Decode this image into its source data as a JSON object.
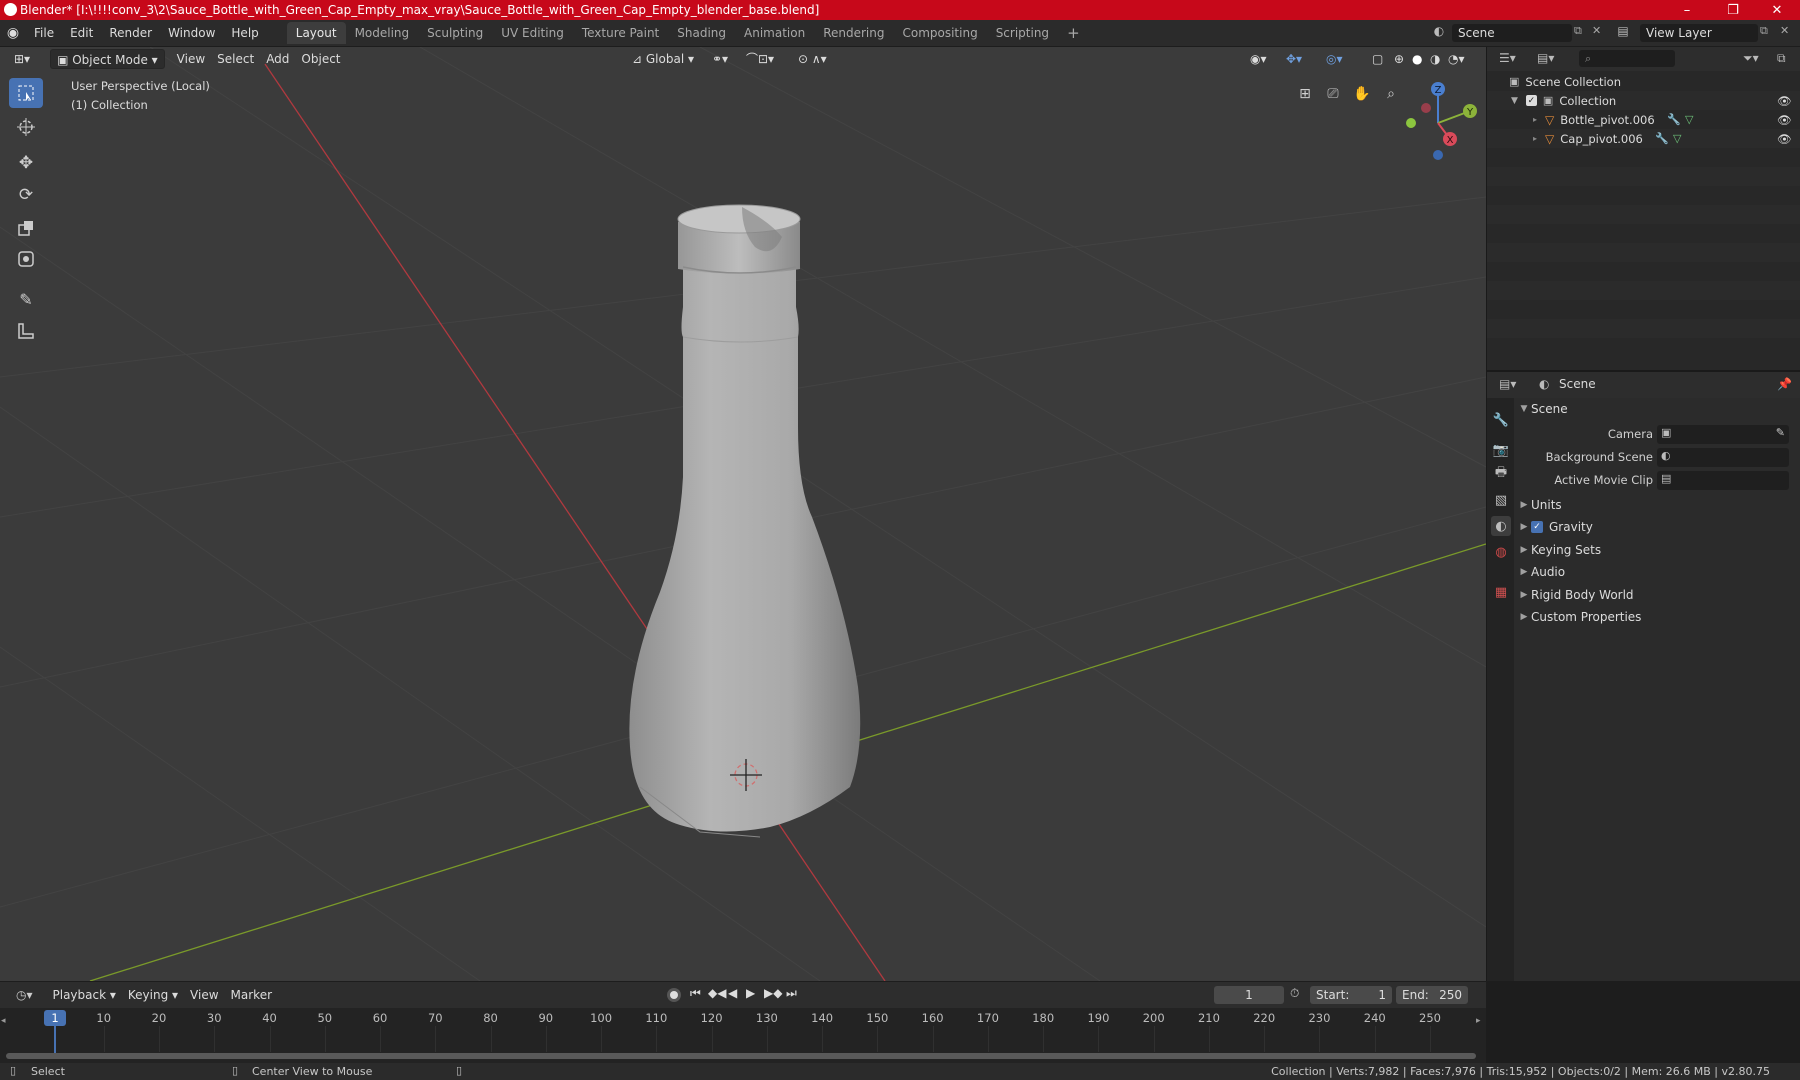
{
  "window": {
    "title": "Blender* [I:\\!!!!conv_3\\2\\Sauce_Bottle_with_Green_Cap_Empty_max_vray\\Sauce_Bottle_with_Green_Cap_Empty_blender_base.blend]",
    "controls": {
      "minimize": "–",
      "maximize": "❐",
      "close": "✕"
    }
  },
  "menubar": {
    "items": [
      "File",
      "Edit",
      "Render",
      "Window",
      "Help"
    ],
    "workspaces": [
      "Layout",
      "Modeling",
      "Sculpting",
      "UV Editing",
      "Texture Paint",
      "Shading",
      "Animation",
      "Rendering",
      "Compositing",
      "Scripting"
    ],
    "active_workspace": "Layout",
    "add_workspace": "+",
    "scene_field": "Scene",
    "view_layer_field": "View Layer"
  },
  "viewport": {
    "mode": "Object Mode",
    "menus": [
      "View",
      "Select",
      "Add",
      "Object"
    ],
    "transform_orientation": "Global",
    "overlay_text": [
      "User Perspective (Local)",
      "(1) Collection"
    ],
    "gizmo_axes": {
      "z": "Z",
      "y": "Y",
      "x": "X"
    }
  },
  "outliner": {
    "search_placeholder": "",
    "root": "Scene Collection",
    "collection": "Collection",
    "objects": [
      "Bottle_pivot.006",
      "Cap_pivot.006"
    ]
  },
  "properties": {
    "context": "Scene",
    "section": "Scene",
    "fields": [
      {
        "label": "Camera",
        "value": ""
      },
      {
        "label": "Background Scene",
        "value": ""
      },
      {
        "label": "Active Movie Clip",
        "value": ""
      }
    ],
    "panels": [
      "Units",
      "Gravity",
      "Keying Sets",
      "Audio",
      "Rigid Body World",
      "Custom Properties"
    ],
    "gravity_checked": true
  },
  "timeline": {
    "menus": [
      "Playback",
      "Keying",
      "View",
      "Marker"
    ],
    "current_frame": "1",
    "start_label": "Start:",
    "start_value": "1",
    "end_label": "End:",
    "end_value": "250",
    "ruler": [
      "1",
      "10",
      "20",
      "30",
      "40",
      "50",
      "60",
      "70",
      "80",
      "90",
      "100",
      "110",
      "120",
      "130",
      "140",
      "150",
      "160",
      "170",
      "180",
      "190",
      "200",
      "210",
      "220",
      "230",
      "240",
      "250"
    ]
  },
  "statusbar": {
    "left_action": "Select",
    "middle_action": "Center View to Mouse",
    "stats": "Collection | Verts:7,982 | Faces:7,976 | Tris:15,952 | Objects:0/2 | Mem: 26.6 MB | v2.80.75"
  },
  "colors": {
    "titlebar": "#c7081a",
    "accent": "#4772b3",
    "x_axis": "#b0393f",
    "y_axis": "#7a9a2a",
    "object_orange": "#e0893a"
  }
}
